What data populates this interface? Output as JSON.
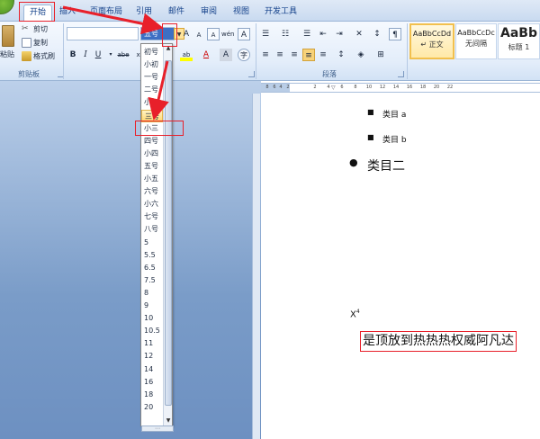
{
  "tabs": [
    {
      "label": "开始",
      "active": true
    },
    {
      "label": "插入"
    },
    {
      "label": "页面布局"
    },
    {
      "label": "引用"
    },
    {
      "label": "邮件"
    },
    {
      "label": "审阅"
    },
    {
      "label": "视图"
    },
    {
      "label": "开发工具"
    }
  ],
  "clipboard": {
    "paste_label": "粘贴",
    "cut_label": "剪切",
    "copy_label": "复制",
    "format_painter_label": "格式刷",
    "group_label": "剪贴板"
  },
  "font": {
    "name_value": "",
    "size_value": "五号",
    "bold": "B",
    "italic": "I",
    "underline": "U",
    "strike": "abe",
    "subscript": "x₂",
    "superscript": "x²",
    "grow": "A",
    "shrink": "A",
    "clear": "A",
    "phonetic": "wén",
    "border_char": "A",
    "highlight": "ab",
    "color": "A",
    "shade": "A",
    "circle": "字"
  },
  "paragraph": {
    "group_label": "段落"
  },
  "styles": [
    {
      "preview": "AaBbCcDd",
      "name": "↵ 正文",
      "selected": true
    },
    {
      "preview": "AaBbCcDc",
      "name": "无间隔"
    },
    {
      "preview": "AaBb",
      "name": "标题 1"
    }
  ],
  "font_size_list": [
    "初号",
    "小初",
    "一号",
    "二号",
    "小二",
    "三号",
    "小三",
    "四号",
    "小四",
    "五号",
    "小五",
    "六号",
    "小六",
    "七号",
    "八号",
    "5",
    "5.5",
    "6.5",
    "7.5",
    "8",
    "9",
    "10",
    "10.5",
    "11",
    "12",
    "14",
    "16",
    "18",
    "20"
  ],
  "font_size_highlighted": "三号",
  "ruler_ticks": [
    "8",
    "6",
    "4",
    "2",
    "2",
    "4",
    "6",
    "8",
    "10",
    "12",
    "14",
    "16",
    "18",
    "20",
    "22"
  ],
  "document": {
    "bullet_items": [
      {
        "marker": "■",
        "text": "类目 a"
      },
      {
        "marker": "■",
        "text": "类目 b"
      }
    ],
    "level1_item": {
      "marker": "●",
      "text": "类目二"
    },
    "superscript_sample": {
      "base": "X",
      "sup": "4"
    },
    "highlighted_sentence": "是顶放到热热热权威阿凡达"
  },
  "colors": {
    "annotation_red": "#e8202a",
    "highlight_yellow": "#ffd870",
    "ribbon_blue": "#dfe9f6",
    "workspace_blue": "#7a9cc8"
  }
}
